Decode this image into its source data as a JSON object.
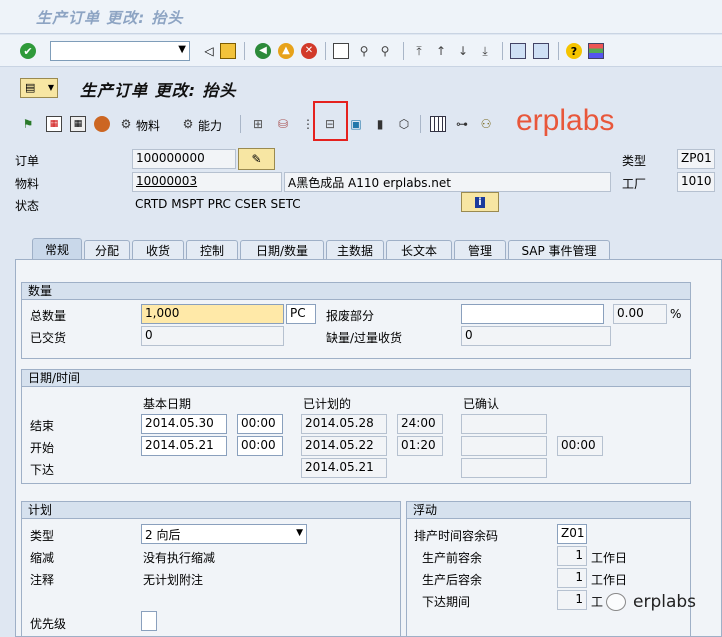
{
  "window": {
    "title": "生产订单 更改: 抬头"
  },
  "app": {
    "title": "生产订单 更改: 抬头"
  },
  "toolbar": {
    "material_label": "物料",
    "capacity_label": "能力"
  },
  "watermark": {
    "text": "erplabs",
    "wechat": "erplabs"
  },
  "header": {
    "order_label": "订单",
    "order_value": "100000000",
    "material_label": "物料",
    "material_value": "10000003",
    "material_desc": "A黑色成品 A110 erplabs.net",
    "status_label": "状态",
    "status_value": "CRTD MSPT PRC  CSER SETC",
    "type_label": "类型",
    "type_value": "ZP01",
    "plant_label": "工厂",
    "plant_value": "1010"
  },
  "tabs": [
    "常规",
    "分配",
    "收货",
    "控制",
    "日期/数量",
    "主数据",
    "长文本",
    "管理",
    "SAP 事件管理"
  ],
  "quantity": {
    "group_title": "数量",
    "total_label": "总数量",
    "total_value": "1,000",
    "unit": "PC",
    "scrap_label": "报废部分",
    "scrap_value": "",
    "scrap_pct": "0.00",
    "pct_sign": "%",
    "delivered_label": "已交货",
    "delivered_value": "0",
    "short_label": "缺量/过量收货",
    "short_value": "0"
  },
  "dates": {
    "group_title": "日期/时间",
    "col_basic": "基本日期",
    "col_sched": "已计划的",
    "col_conf": "已确认",
    "end_label": "结束",
    "end_date": "2014.05.30",
    "end_time": "00:00",
    "end_sched_date": "2014.05.28",
    "end_sched_time": "24:00",
    "start_label": "开始",
    "start_date": "2014.05.21",
    "start_time": "00:00",
    "start_sched_date": "2014.05.22",
    "start_sched_time": "01:20",
    "start_conf_time": "00:00",
    "release_label": "下达",
    "release_sched_date": "2014.05.21"
  },
  "plan": {
    "group_title": "计划",
    "type_label": "类型",
    "type_value": "2 向后",
    "reduce_label": "缩减",
    "reduce_value": "没有执行缩减",
    "note_label": "注释",
    "note_value": "无计划附注",
    "priority_label": "优先级"
  },
  "float": {
    "group_title": "浮动",
    "key_label": "排产时间容余码",
    "key_value": "Z01",
    "before_label": "生产前容余",
    "before_value": "1",
    "before_unit": "工作日",
    "after_label": "生产后容余",
    "after_value": "1",
    "after_unit": "工作日",
    "release_label": "下达期间",
    "release_value": "1",
    "release_unit": "工"
  }
}
